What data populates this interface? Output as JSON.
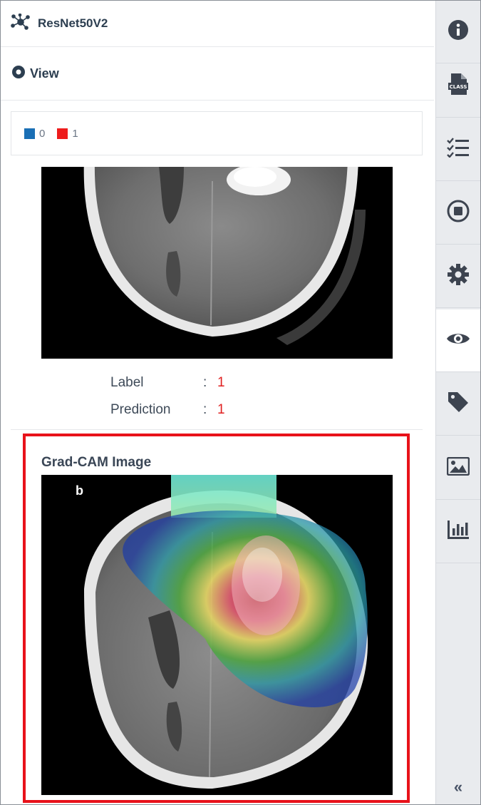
{
  "header": {
    "title": "ResNet50V2",
    "icon": "network-icon"
  },
  "view": {
    "label": "View",
    "icon": "radio-dot-icon"
  },
  "legend": [
    {
      "label": "0",
      "color": "#1a6fb5"
    },
    {
      "label": "1",
      "color": "#ee1c1c"
    }
  ],
  "result": {
    "label_key": "Label",
    "label_sep": ":",
    "label_value": "1",
    "prediction_key": "Prediction",
    "prediction_sep": ":",
    "prediction_value": "1"
  },
  "gradcam": {
    "title": "Grad-CAM Image",
    "panel_letter": "b"
  },
  "sidebar": {
    "items": [
      "info-icon",
      "class-file-icon",
      "checklist-icon",
      "stop-icon",
      "gear-icon",
      "eye-icon",
      "tag-icon",
      "image-icon",
      "bar-chart-icon"
    ],
    "active": "eye-icon",
    "collapse": "«"
  }
}
